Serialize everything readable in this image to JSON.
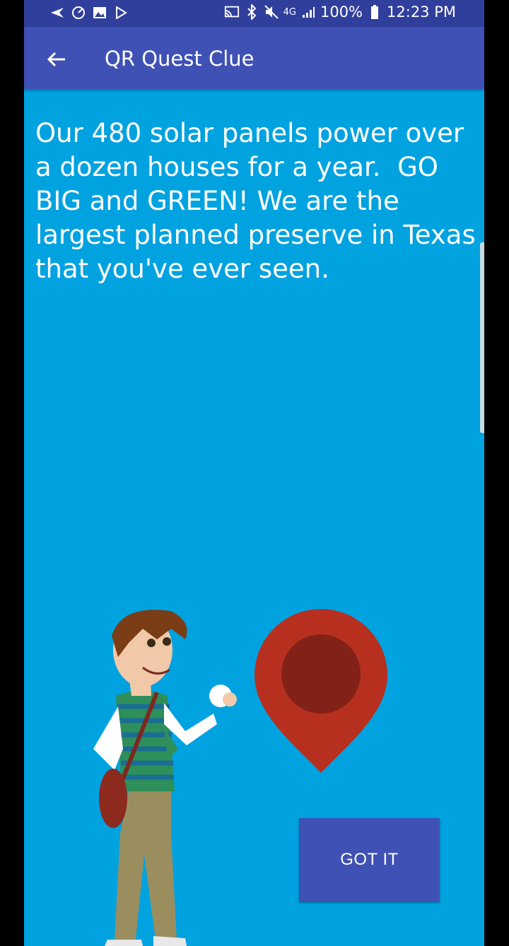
{
  "status_bar": {
    "battery": "100%",
    "time": "12:23 PM",
    "network": "4G",
    "icons": [
      "navigation-icon",
      "speedometer-icon",
      "image-icon",
      "play-store-icon",
      "cast-icon",
      "bluetooth-icon",
      "mute-icon",
      "signal-icon",
      "battery-icon"
    ]
  },
  "app_bar": {
    "title": "QR Quest Clue",
    "back_icon": "arrow-left-icon"
  },
  "clue": {
    "text": "Our 480 solar panels power over a dozen houses for a year.  GO BIG and GREEN! We are the largest planned preserve in Texas that you've ever seen."
  },
  "button": {
    "label": "GOT IT"
  },
  "colors": {
    "status_bar": "#313f9c",
    "app_bar": "#3f51b5",
    "background": "#00a2e0",
    "pin_outer": "#b7301f",
    "pin_inner": "#822117",
    "button": "#3f51b5"
  }
}
